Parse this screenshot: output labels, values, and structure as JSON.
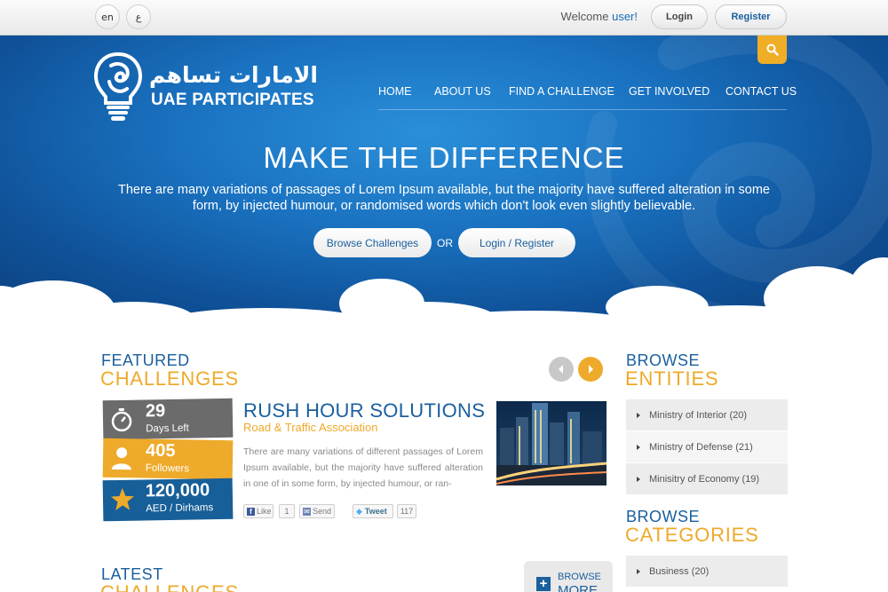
{
  "topbar": {
    "lang_en": "en",
    "lang_ar": "ع",
    "welcome_prefix": "Welcome ",
    "welcome_user": "user!",
    "login_label": "Login",
    "register_label": "Register"
  },
  "brand": {
    "name_ar": "الامارات تساهم",
    "name_en": "UAE PARTICIPATES"
  },
  "nav": {
    "items": [
      "HOME",
      "ABOUT US",
      "FIND A CHALLENGE",
      "GET INVOLVED",
      "CONTACT US"
    ]
  },
  "hero": {
    "title": "MAKE THE DIFFERENCE",
    "description": "There are many variations of passages of Lorem Ipsum available, but the majority have suffered alteration in some form, by injected humour, or randomised words which don't look even slightly believable.",
    "browse_label": "Browse Challenges",
    "or_label": "OR",
    "login_label": "Login / Register"
  },
  "featured": {
    "heading_top": "FEATURED",
    "heading_bottom": "CHALLENGES",
    "stats": {
      "days_value": "29",
      "days_label": "Days Left",
      "followers_value": "405",
      "followers_label": "Followers",
      "amount_value": "120,000",
      "amount_label": "AED / Dirhams"
    },
    "challenge": {
      "title": "RUSH HOUR SOLUTIONS",
      "subtitle": "Road & Traffic Association",
      "description": "There are many variations of different passages of Lorem Ipsum available, but the majority have suffered alteration in one of in some form, by injected humour, or ran-"
    },
    "social": {
      "like_label": "Like",
      "like_count": "1",
      "send_label": "Send",
      "tweet_label": "Tweet",
      "tweet_count": "117"
    }
  },
  "latest": {
    "heading_top": "LATEST",
    "heading_bottom": "CHALLENGES",
    "browse_more_line1": "BROWSE",
    "browse_more_line2": "MORE"
  },
  "sidebar": {
    "entities_top": "BROWSE",
    "entities_bottom": "ENTITIES",
    "entities": [
      "Ministry of Interior (20)",
      "Ministry of Defense (21)",
      "Minisitry of Economy (19)"
    ],
    "categories_top": "BROWSE",
    "categories_bottom": "CATEGORIES",
    "categories": [
      "Business (20)"
    ]
  },
  "colors": {
    "brand_blue": "#1a5f9e",
    "accent_orange": "#eeaa2a",
    "hero_blue": "#1a72c0"
  }
}
